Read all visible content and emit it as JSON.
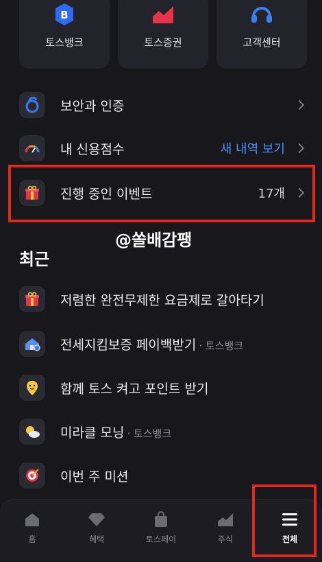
{
  "shortcuts": [
    {
      "label": "토스뱅크",
      "icon": "toss-bank-icon",
      "letter": "B"
    },
    {
      "label": "토스증권",
      "icon": "stock-chart-icon"
    },
    {
      "label": "고객센터",
      "icon": "headset-icon"
    }
  ],
  "menu": [
    {
      "label": "보안과 인증",
      "icon": "security-lock-icon"
    },
    {
      "label": "내 신용점수",
      "icon": "credit-gauge-icon",
      "value": "새 내역 보기"
    },
    {
      "label": "진행 중인 이벤트",
      "icon": "gift-icon",
      "value": "17개"
    }
  ],
  "watermark": "@쏠배감팽",
  "recent_title": "최근",
  "recent": [
    {
      "label": "저렴한 완전무제한 요금제로 갈아타기",
      "icon": "gift-icon",
      "sub": ""
    },
    {
      "label": "전세지킴보증 페이백받기",
      "icon": "house-shield-icon",
      "sub": "· 토스뱅크"
    },
    {
      "label": "함께 토스 켜고 포인트 받기",
      "icon": "location-pin-icon",
      "sub": ""
    },
    {
      "label": "미라클 모닝",
      "icon": "sun-cloud-icon",
      "sub": "· 토스뱅크"
    },
    {
      "label": "이번 주 미션",
      "icon": "target-icon",
      "sub": ""
    }
  ],
  "nav": [
    {
      "label": "홈",
      "icon": "home-icon"
    },
    {
      "label": "혜택",
      "icon": "diamond-icon"
    },
    {
      "label": "토스페이",
      "icon": "shopping-bag-icon"
    },
    {
      "label": "주식",
      "icon": "chart-icon"
    },
    {
      "label": "전체",
      "icon": "menu-icon",
      "active": true
    }
  ],
  "colors": {
    "accent_blue": "#4b8ef5",
    "highlight_red": "#e0291f",
    "background": "#17171c"
  }
}
